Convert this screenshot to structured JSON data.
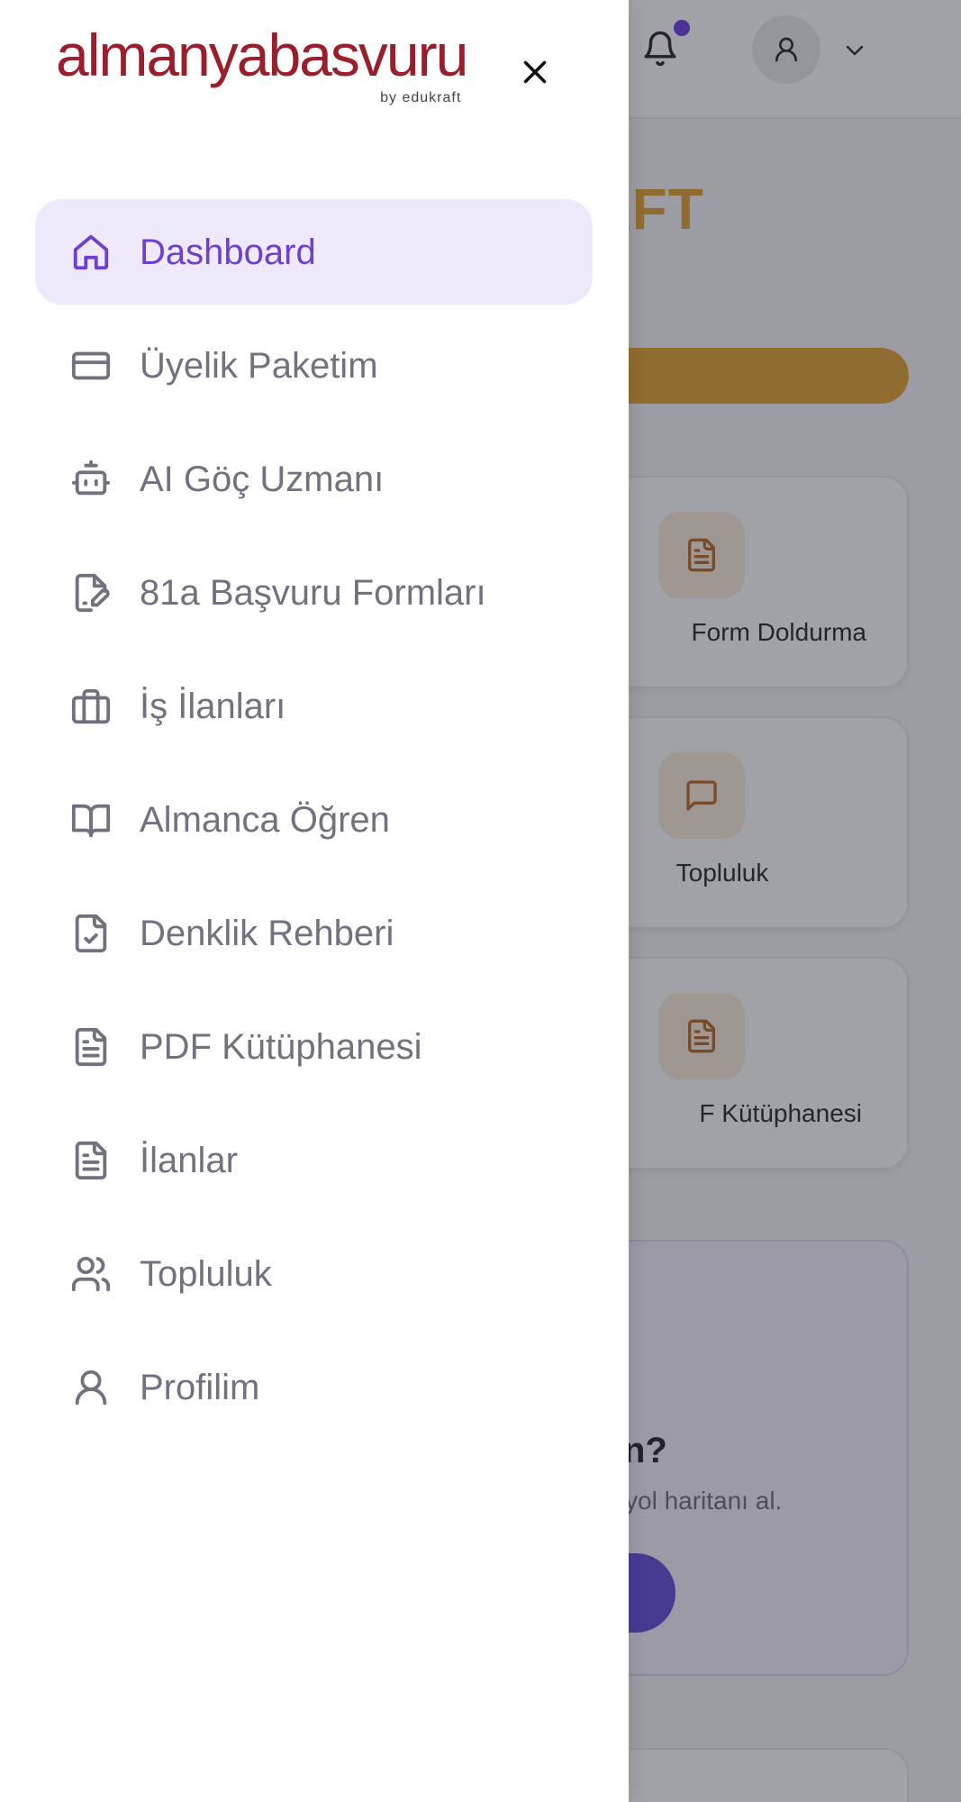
{
  "background": {
    "brand_heading": "KRAFT",
    "cards": [
      {
        "label": "Form Doldurma",
        "icon": "document-icon"
      },
      {
        "label": "Topluluk",
        "icon": "chat-bubble-icon"
      },
      {
        "label": "F Kütüphanesi",
        "icon": "document-icon"
      }
    ],
    "promo": {
      "question": "n?",
      "subtitle": "yol haritanı al."
    }
  },
  "header": {
    "notification_icon": "bell-icon",
    "profile_icon": "user-icon",
    "menu_icon": "chevron-down-icon"
  },
  "drawer": {
    "logo": {
      "main": "almanyabasvuru",
      "sub": "by edukraft"
    },
    "close_icon": "close-icon",
    "items": [
      {
        "label": "Dashboard",
        "icon": "home-icon",
        "active": true
      },
      {
        "label": "Üyelik Paketim",
        "icon": "credit-card-icon",
        "active": false
      },
      {
        "label": "AI Göç Uzmanı",
        "icon": "robot-icon",
        "active": false
      },
      {
        "label": "81a Başvuru Formları",
        "icon": "file-edit-icon",
        "active": false
      },
      {
        "label": "İş İlanları",
        "icon": "briefcase-icon",
        "active": false
      },
      {
        "label": "Almanca Öğren",
        "icon": "book-open-icon",
        "active": false
      },
      {
        "label": "Denklik Rehberi",
        "icon": "file-check-icon",
        "active": false
      },
      {
        "label": "PDF Kütüphanesi",
        "icon": "document-icon",
        "active": false
      },
      {
        "label": "İlanlar",
        "icon": "document-icon",
        "active": false
      },
      {
        "label": "Topluluk",
        "icon": "users-icon",
        "active": false
      },
      {
        "label": "Profilim",
        "icon": "user-icon",
        "active": false
      }
    ]
  },
  "colors": {
    "accent": "#6f3fd0",
    "active_bg": "#eeeafc",
    "brand": "#9a1f2c",
    "orange": "#e0a12a",
    "nav_text": "#73707f",
    "notification_dot": "#6b3ce0"
  }
}
